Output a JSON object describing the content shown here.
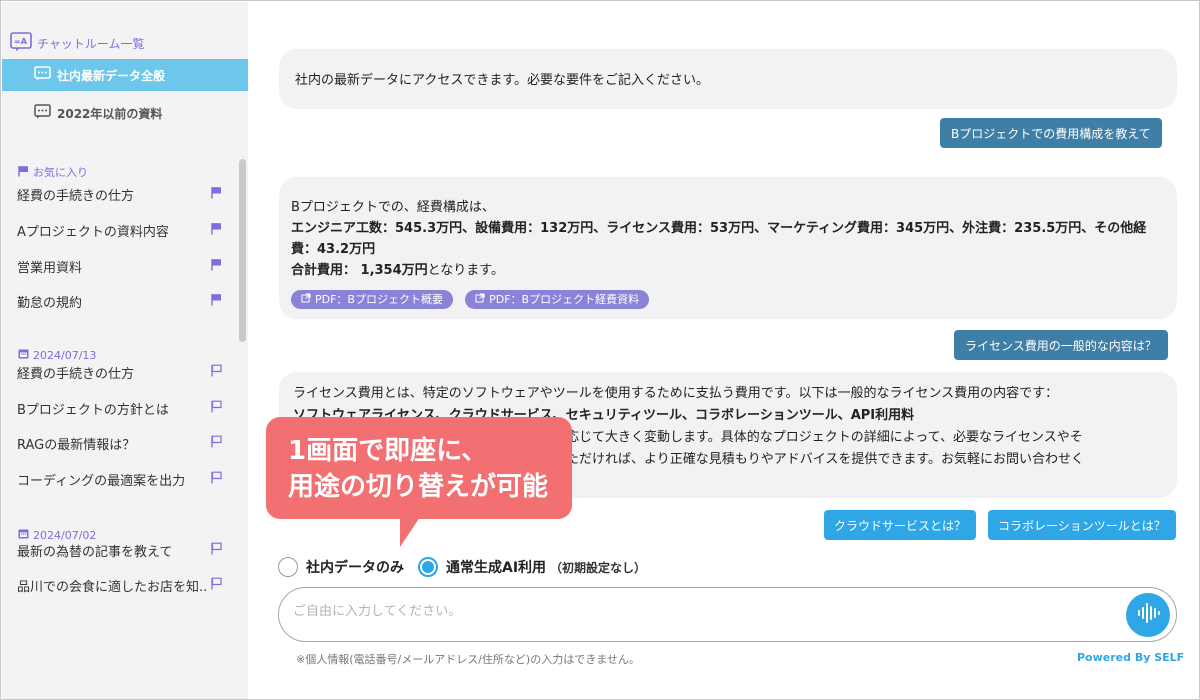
{
  "sidebar": {
    "header": "チャットルーム一覧",
    "rooms": [
      {
        "label": "社内最新データ全般",
        "active": true
      },
      {
        "label": "2022年以前の資料",
        "active": false
      }
    ],
    "favorites": {
      "title": "お気に入り",
      "items": [
        "経費の手続きの仕方",
        "Aプロジェクトの資料内容",
        "営業用資料",
        "勤怠の規約"
      ]
    },
    "history": [
      {
        "date": "2024/07/13",
        "items": [
          "経費の手続きの仕方",
          "Bプロジェクトの方針とは",
          "RAGの最新情報は？",
          "コーディングの最適案を出力"
        ]
      },
      {
        "date": "2024/07/02",
        "items": [
          "最新の為替の記事を教えて",
          "品川での会食に適したお店を知.."
        ]
      }
    ]
  },
  "chat": {
    "bot1": "社内の最新データにアクセスできます。必要な要件をご記入ください。",
    "user1": "Bプロジェクトでの費用構成を教えて",
    "bot2": {
      "line1": "Bプロジェクトでの、経費構成は、",
      "line2": "エンジニア工数：545.3万円、設備費用：132万円、ライセンス費用：53万円、マーケティング費用：345万円、外注費：235.5万円、その他経費：43.2万円",
      "line3_bold": "合計費用： 1,354万円",
      "line3_rest": "となります。",
      "chips": [
        "PDF：Bプロジェクト概要",
        "PDF：Bプロジェクト経費資料"
      ]
    },
    "user2": "ライセンス費用の一般的な内容は？",
    "bot3": {
      "line1": "ライセンス費用とは、特定のソフトウェアやツールを使用するために支払う費用です。以下は一般的なライセンス費用の内容です：",
      "line2": "ソフトウェアライセンス、クラウドサービス、セキュリティツール、コラボレーションツール、API利用料",
      "line3": "に応じて大きく変動します。具体的なプロジェクトの詳細によって、必要なライセンスやそ",
      "line4": "いただければ、より正確な見積もりやアドバイスを提供できます。お気軽にお問い合わせく"
    },
    "suggestions": [
      "クラウドサービスとは？",
      "コラボレーションツールとは？"
    ]
  },
  "callout": {
    "line1": "1画面で即座に、",
    "line2": "用途の切り替えが可能"
  },
  "mode": {
    "option1": "社内データのみ",
    "option2": "通常生成AI利用",
    "option2_note": "（初期設定なし）",
    "selected": "option2"
  },
  "input": {
    "placeholder": "ご自由に入力してください。",
    "value": ""
  },
  "footnote": "※個人情報(電話番号/メールアドレス/住所など)の入力はできません。",
  "powered_by": "Powered By SELF",
  "colors": {
    "accent": "#2fa7e6",
    "room_active": "#6cc7ea",
    "user_bubble": "#3f7ea6",
    "callout": "#f26f72",
    "chip": "#8a83d9",
    "sidebar_label": "#7b6ee0"
  }
}
